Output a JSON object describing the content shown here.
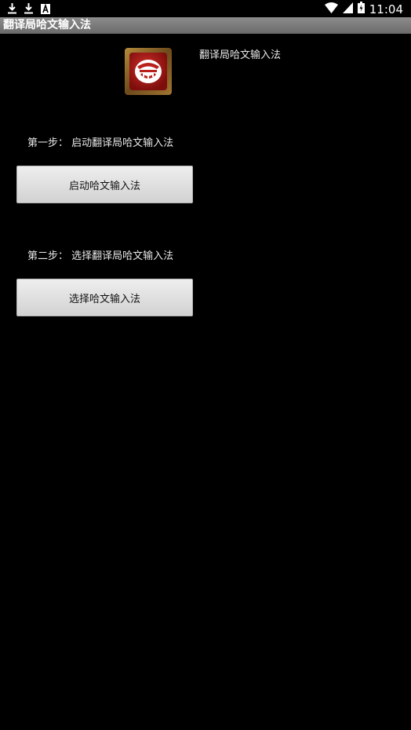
{
  "status_bar": {
    "time": "11:04",
    "left_icons": [
      "download-icon",
      "download-icon",
      "notification-a-icon"
    ],
    "right_icons": [
      "wifi-icon",
      "signal-icon",
      "battery-icon"
    ]
  },
  "title_bar": {
    "title": "翻译局哈文输入法"
  },
  "header": {
    "app_name": "翻译局哈文输入法",
    "icon": "app-logo-icon"
  },
  "steps": [
    {
      "label": "第一步： 启动翻译局哈文输入法",
      "button_label": "启动哈文输入法"
    },
    {
      "label": "第二步： 选择翻译局哈文输入法",
      "button_label": "选择哈文输入法"
    }
  ],
  "colors": {
    "background": "#000000",
    "title_bar": "#7a7a7a",
    "button_bg": "#e0e0e0",
    "icon_red": "#b8201c",
    "icon_frame": "#a07532"
  }
}
